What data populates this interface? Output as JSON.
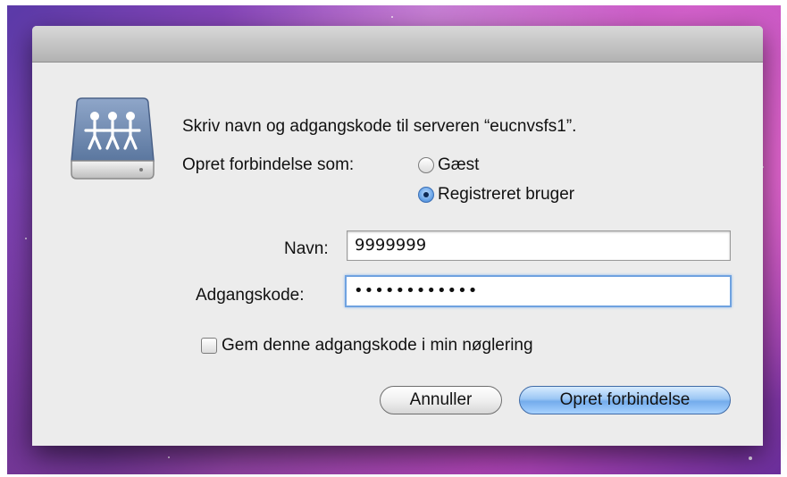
{
  "dialog": {
    "prompt_text": "Skriv navn og adgangskode til serveren “eucnvsfs1”.",
    "connect_as_label": "Opret forbindelse som:",
    "options": [
      {
        "label": "Gæst",
        "selected": false
      },
      {
        "label": "Registreret bruger",
        "selected": true
      }
    ],
    "name_label": "Navn:",
    "name_value": "9999999",
    "password_label": "Adgangskode:",
    "password_value": "••••••••••••",
    "keychain_label": "Gem denne adgangskode i min nøglering",
    "keychain_checked": false,
    "cancel_label": "Annuller",
    "connect_label": "Opret forbindelse",
    "icon": "shared-server-icon"
  },
  "colors": {
    "accent": "#74acec",
    "dialog_bg": "#ececec"
  }
}
